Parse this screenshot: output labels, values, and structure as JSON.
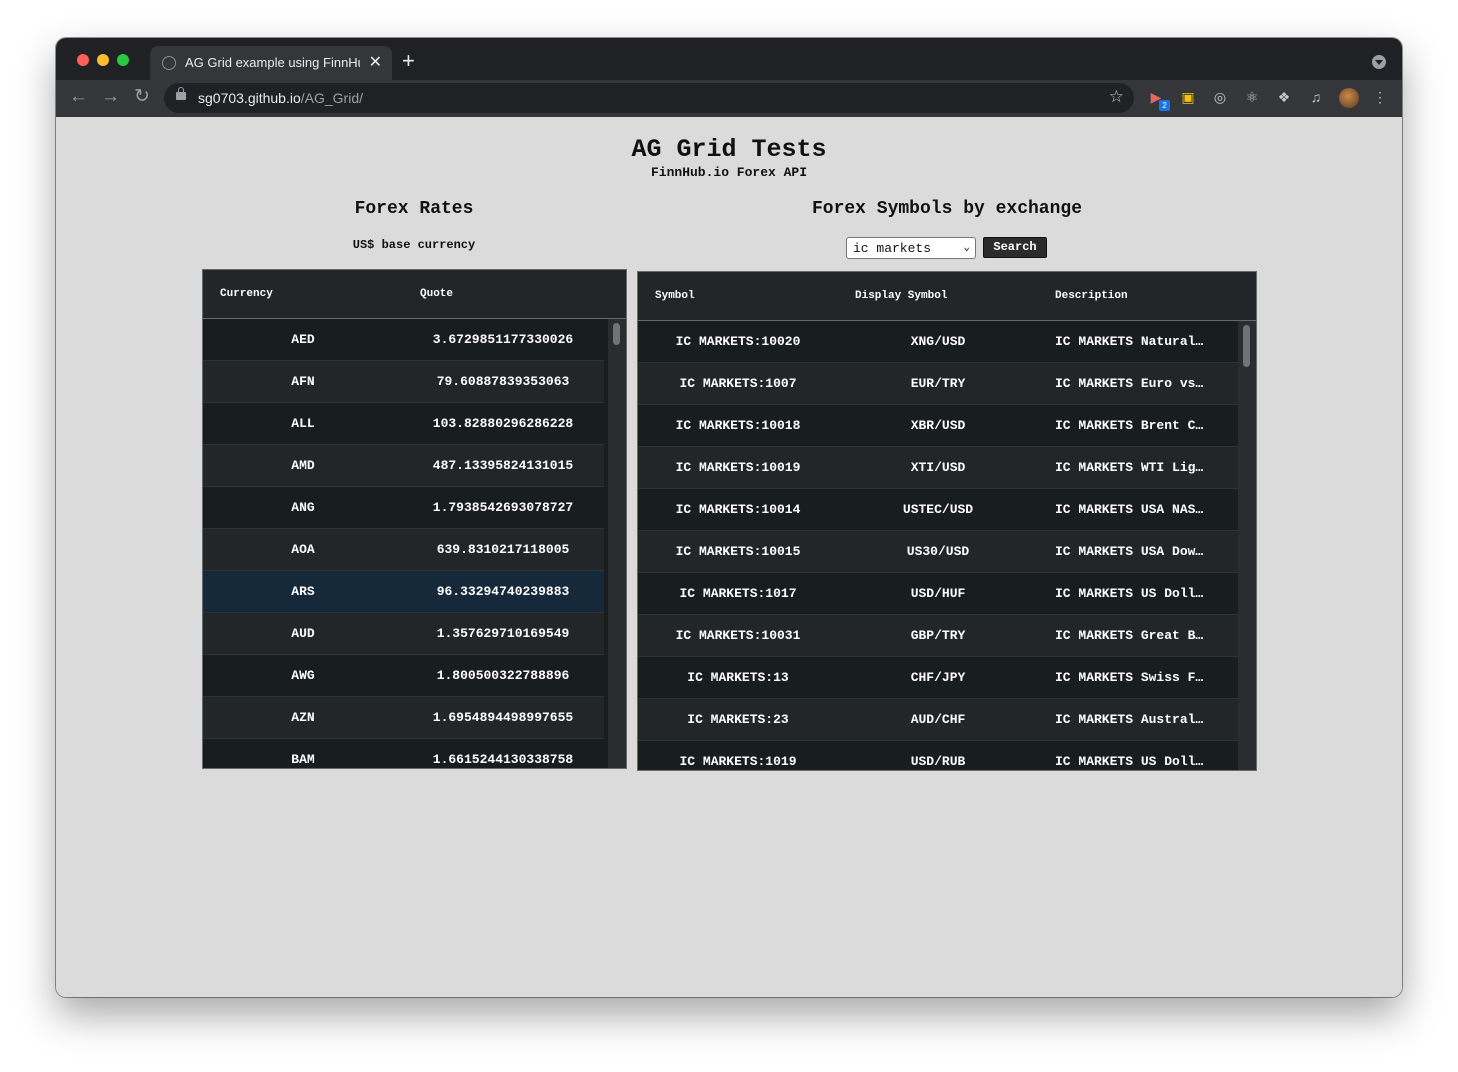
{
  "browser": {
    "tab_title": "AG Grid example using FinnHub.io",
    "tab_close": "✕",
    "new_tab": "+",
    "url_host": "sg0703.github.io",
    "url_path": "/AG_Grid/",
    "extension_badge": "2",
    "icons": [
      "back-icon",
      "forward-icon",
      "reload-icon",
      "lock-icon",
      "star-icon",
      "extension-icon",
      "puzzle-icon",
      "media-icon",
      "menu-icon"
    ]
  },
  "page": {
    "title": "AG Grid Tests",
    "subtitle": "FinnHub.io Forex API",
    "rates": {
      "heading": "Forex Rates",
      "note": "US$ base currency",
      "columns": [
        "Currency",
        "Quote"
      ],
      "rows": [
        {
          "currency": "AED",
          "quote": "3.67298511773300​26"
        },
        {
          "currency": "AFN",
          "quote": "79.60887839353063"
        },
        {
          "currency": "ALL",
          "quote": "103.82880296286228"
        },
        {
          "currency": "AMD",
          "quote": "487.13395824131015"
        },
        {
          "currency": "ANG",
          "quote": "1.7938542693078727"
        },
        {
          "currency": "AOA",
          "quote": "639.8310217118005"
        },
        {
          "currency": "ARS",
          "quote": "96.33294740239883"
        },
        {
          "currency": "AUD",
          "quote": "1.357629710169549"
        },
        {
          "currency": "AWG",
          "quote": "1.800500322788896"
        },
        {
          "currency": "AZN",
          "quote": "1.6954894498997655"
        },
        {
          "currency": "BAM",
          "quote": "1.6615244130338758"
        }
      ],
      "selected_index": 6
    },
    "symbols": {
      "heading": "Forex Symbols by exchange",
      "exchange_selected": "ic markets",
      "search_label": "Search",
      "columns": [
        "Symbol",
        "Display Symbol",
        "Description"
      ],
      "rows": [
        {
          "symbol": "IC MARKETS:10020",
          "display": "XNG/USD",
          "description": "IC MARKETS Natural…"
        },
        {
          "symbol": "IC MARKETS:1007",
          "display": "EUR/TRY",
          "description": "IC MARKETS Euro vs…"
        },
        {
          "symbol": "IC MARKETS:10018",
          "display": "XBR/USD",
          "description": "IC MARKETS Brent C…"
        },
        {
          "symbol": "IC MARKETS:10019",
          "display": "XTI/USD",
          "description": "IC MARKETS WTI Lig…"
        },
        {
          "symbol": "IC MARKETS:10014",
          "display": "USTEC/USD",
          "description": "IC MARKETS USA NAS…"
        },
        {
          "symbol": "IC MARKETS:10015",
          "display": "US30/USD",
          "description": "IC MARKETS USA Dow…"
        },
        {
          "symbol": "IC MARKETS:1017",
          "display": "USD/HUF",
          "description": "IC MARKETS US Doll…"
        },
        {
          "symbol": "IC MARKETS:10031",
          "display": "GBP/TRY",
          "description": "IC MARKETS Great B…"
        },
        {
          "symbol": "IC MARKETS:13",
          "display": "CHF/JPY",
          "description": "IC MARKETS Swiss F…"
        },
        {
          "symbol": "IC MARKETS:23",
          "display": "AUD/CHF",
          "description": "IC MARKETS Austral…"
        },
        {
          "symbol": "IC MARKETS:1019",
          "display": "USD/RUB",
          "description": "IC MARKETS US Doll…"
        }
      ]
    }
  }
}
